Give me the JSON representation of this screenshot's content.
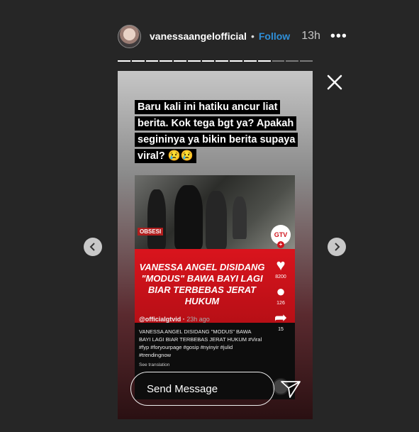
{
  "header": {
    "username": "vanessaangelofficial",
    "separator": "•",
    "follow_label": "Follow",
    "time": "13h",
    "more": "•••"
  },
  "progress": {
    "segments": 14,
    "completed": 11
  },
  "story": {
    "caption": "Baru kali ini hatiku ancur liat berita. Kok tega bgt ya? Apakah segininya ya bikin berita supaya viral? 😢😢",
    "video": {
      "watermark": "OBSESI",
      "channel_badge": "GTV",
      "headline": "VANESSA ANGEL DISIDANG \"MODUS\" BAWA BAYI LAGI BIAR TERBEBAS JERAT HUKUM",
      "likes": "8200",
      "comments": "126",
      "shares": "15",
      "handle": "@officialgtvid",
      "posted": "23h ago",
      "description": "VANESSA ANGEL DISIDANG \"MODUS\" BAWA BAYI LAGI BIAR TERBEBAS JERAT HUKUM #Viral #fyp #foryourpage #gosip #nyinyir #julid #trendingnow",
      "see_translation": "See translation"
    }
  },
  "composer": {
    "placeholder": "Send Message"
  },
  "icons": {
    "close": "close-icon",
    "prev": "chevron-left-icon",
    "next": "chevron-right-icon",
    "send": "paper-plane-icon"
  }
}
